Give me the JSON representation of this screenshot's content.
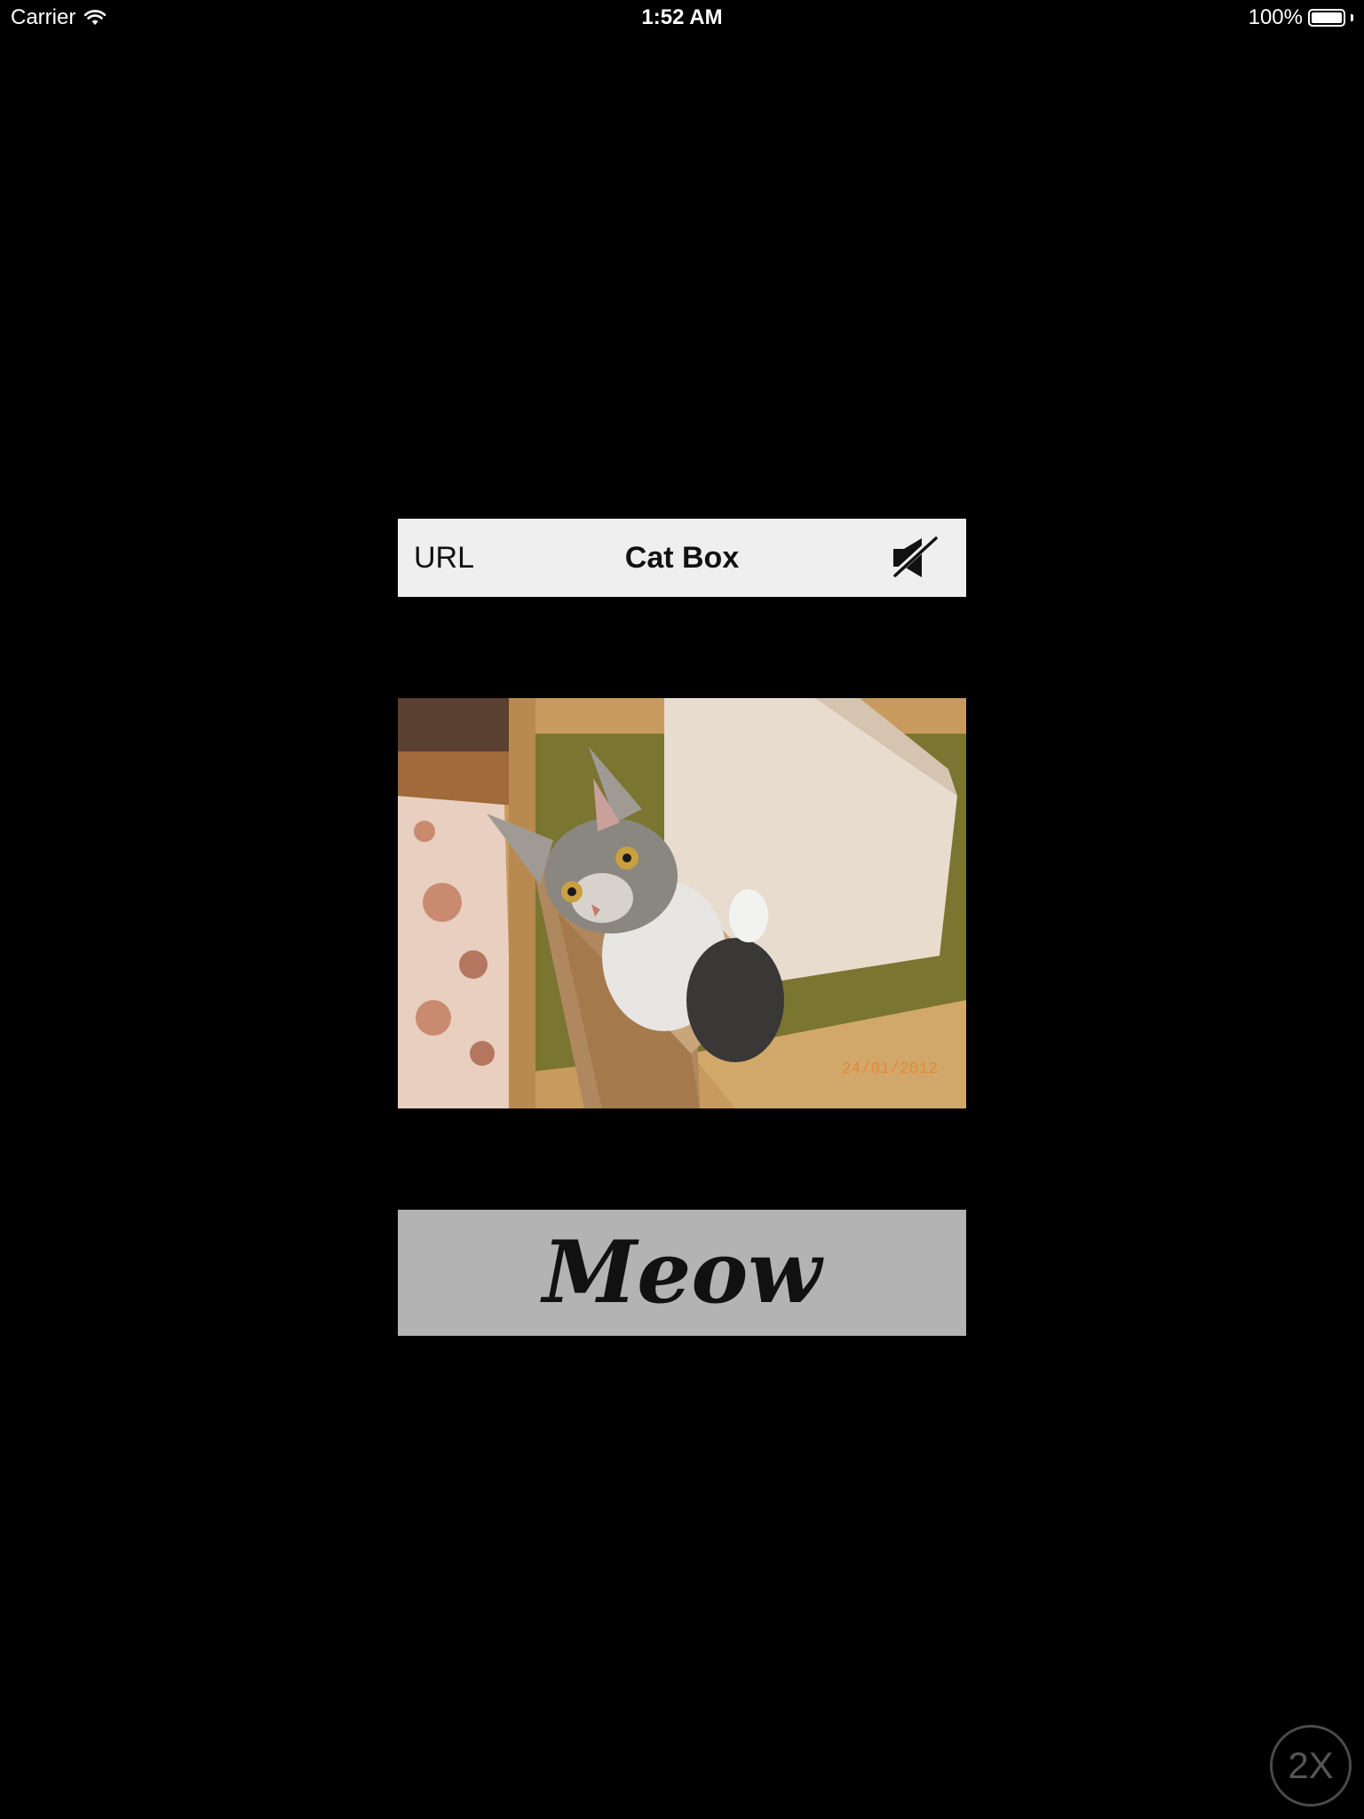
{
  "status_bar": {
    "carrier": "Carrier",
    "time": "1:52 AM",
    "battery": "100%"
  },
  "toolbar": {
    "url_label": "URL",
    "title": "Cat Box",
    "mute_icon": "speaker-muted-icon"
  },
  "photo": {
    "date_stamp": "24/01/2012"
  },
  "meow_button": {
    "label": "Meow"
  },
  "zoom_badge": {
    "label": "2X"
  },
  "colors": {
    "background": "#000000",
    "toolbar_bg": "#efefef",
    "meow_bg": "#b3b3b3"
  }
}
